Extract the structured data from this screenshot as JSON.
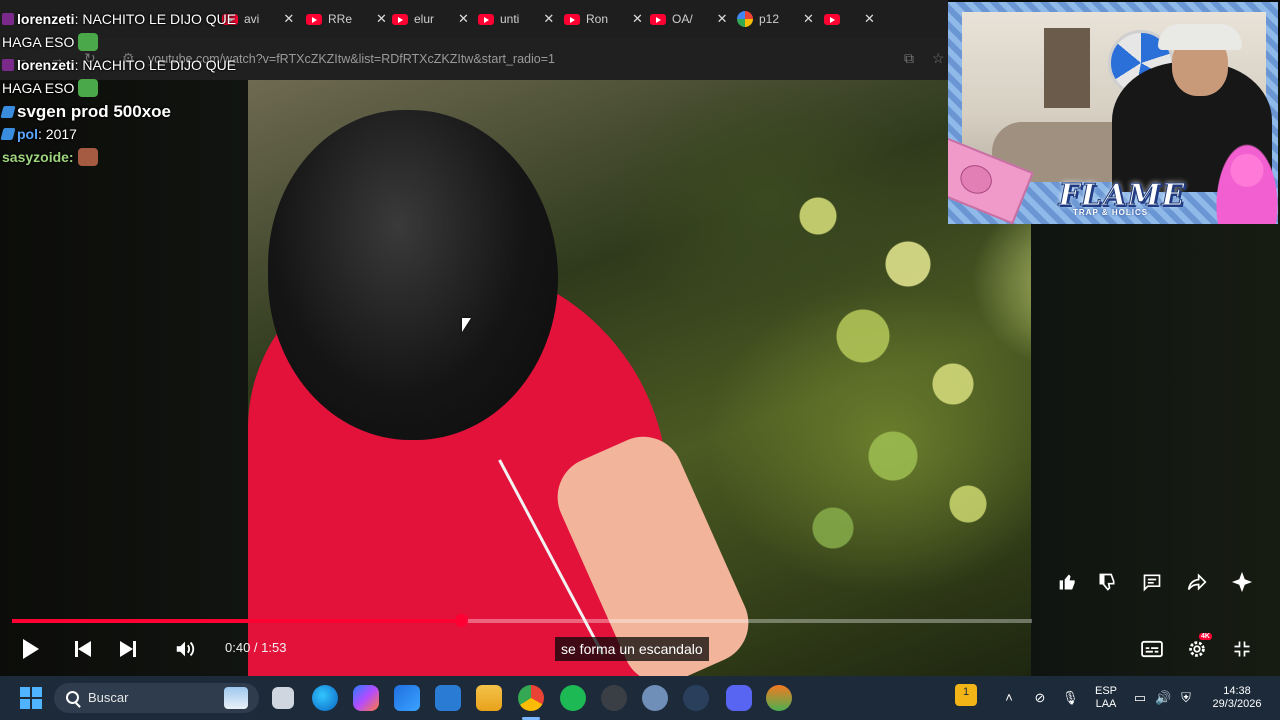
{
  "browser": {
    "tabs": [
      {
        "label": "avi"
      },
      {
        "label": "RRe"
      },
      {
        "label": "elur"
      },
      {
        "label": "unti"
      },
      {
        "label": "Ron"
      },
      {
        "label": "OA/"
      },
      {
        "label": "p12"
      }
    ],
    "url": "youtube.com/watch?v=fRTXcZKZItw&list=RDfRTXcZKZItw&start_radio=1"
  },
  "chat": {
    "messages": [
      {
        "user": "lorenzeti",
        "text": "NACHITO LE DIJO QUE"
      },
      {
        "user": "",
        "text": "HAGA ESO"
      },
      {
        "user": "lorenzeti",
        "text": "NACHITO LE DIJO QUE"
      },
      {
        "user": "",
        "text": "HAGA ESO"
      },
      {
        "user": "",
        "text": "svgen prod 500xoe"
      },
      {
        "user": "pol",
        "text": ": 2017"
      },
      {
        "user": "sasyzoide:",
        "text": ""
      }
    ]
  },
  "webcam": {
    "brand": "FLAME",
    "tagline": "TRAP & HOLICS"
  },
  "player": {
    "progress": 0.44,
    "time": "0:40 / 1:53",
    "caption": "se forma un escandalo",
    "quality_badge": "4K",
    "accent": "#ff0033"
  },
  "taskbar": {
    "search_placeholder": "Buscar",
    "lang_top": "ESP",
    "lang_bottom": "LAA",
    "time": "14:38",
    "date": "29/3/2026",
    "notification_count": "1"
  }
}
